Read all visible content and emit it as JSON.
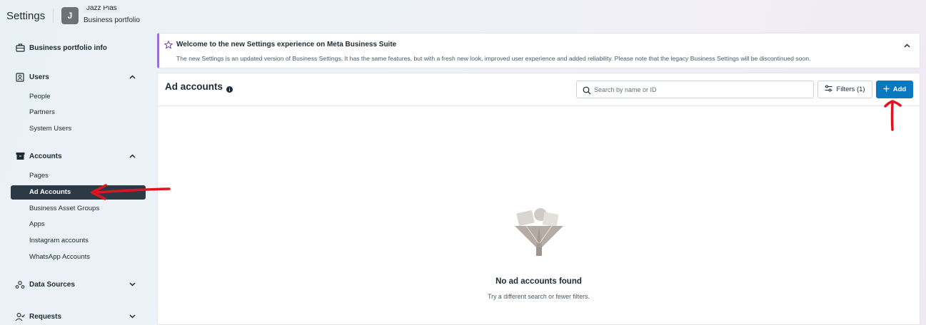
{
  "header": {
    "title": "Settings",
    "avatar_letter": "J",
    "portfolio_name": "Jazz Pias",
    "portfolio_subtitle": "Business portfolio"
  },
  "sidebar": {
    "portfolio_info": {
      "label": "Business portfolio info",
      "icon": "briefcase-icon"
    },
    "users": {
      "label": "Users",
      "icon": "user-card-icon",
      "expanded": true,
      "items": [
        {
          "label": "People"
        },
        {
          "label": "Partners"
        },
        {
          "label": "System Users"
        }
      ]
    },
    "accounts": {
      "label": "Accounts",
      "icon": "archive-box-icon",
      "expanded": true,
      "items": [
        {
          "label": "Pages",
          "active": false
        },
        {
          "label": "Ad Accounts",
          "active": true
        },
        {
          "label": "Business Asset Groups",
          "active": false
        },
        {
          "label": "Apps",
          "active": false
        },
        {
          "label": "Instagram accounts",
          "active": false
        },
        {
          "label": "WhatsApp Accounts",
          "active": false
        }
      ]
    },
    "data_sources": {
      "label": "Data Sources",
      "icon": "people-network-icon",
      "expanded": false
    },
    "requests": {
      "label": "Requests",
      "icon": "user-check-icon",
      "expanded": false
    }
  },
  "banner": {
    "title": "Welcome to the new Settings experience on Meta Business Suite",
    "text": "The new Settings is an updated version of Business Settings. It has the same features, but with a fresh new look, improved user experience and added reliability. Please note that the legacy Business Settings will be discontinued soon.",
    "accent_color": "#9b6fd6"
  },
  "main": {
    "title": "Ad accounts",
    "search_placeholder": "Search by name or ID",
    "filters_label": "Filters (1)",
    "add_label": "Add",
    "add_color": "#0a78be",
    "empty_title": "No ad accounts found",
    "empty_subtitle": "Try a different search or fewer filters."
  },
  "colors": {
    "active_item_bg": "#2b3a44",
    "annotation_red": "#e0141e"
  }
}
